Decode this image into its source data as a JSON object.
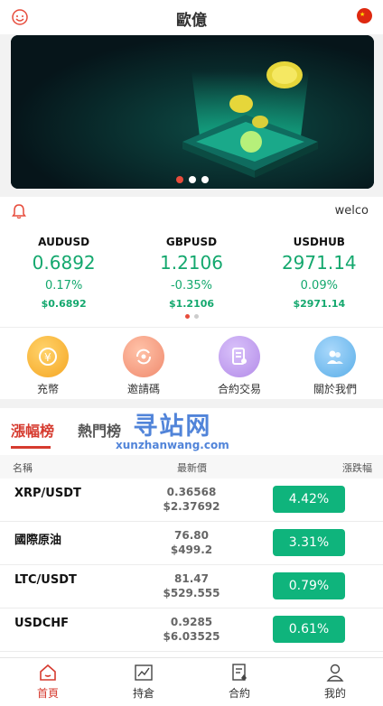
{
  "header": {
    "title": "歐億"
  },
  "notice": {
    "text": "welco"
  },
  "quotes": [
    {
      "symbol": "AUDUSD",
      "price": "0.6892",
      "percent": "0.17%",
      "sub": "$0.6892"
    },
    {
      "symbol": "GBPUSD",
      "price": "1.2106",
      "percent": "-0.35%",
      "sub": "$1.2106"
    },
    {
      "symbol": "USDHUB",
      "price": "2971.14",
      "percent": "0.09%",
      "sub": "$2971.14"
    }
  ],
  "shortcuts": [
    {
      "label": "充幣",
      "icon": "deposit-icon",
      "color": "#f5a623"
    },
    {
      "label": "邀請碼",
      "icon": "invite-icon",
      "color": "#f08a6e"
    },
    {
      "label": "合約交易",
      "icon": "contract-icon",
      "color": "#b38be8"
    },
    {
      "label": "關於我們",
      "icon": "about-icon",
      "color": "#5aaee8"
    }
  ],
  "rank": {
    "tabs": [
      "漲幅榜",
      "熱門榜"
    ],
    "watermark": {
      "big": "寻站网",
      "small": "xunzhanwang.com"
    },
    "columns": {
      "name": "名稱",
      "price": "最新價",
      "change": "漲跌幅"
    },
    "rows": [
      {
        "name": "XRP/USDT",
        "price": "0.36568",
        "price_usd": "$2.37692",
        "change": "4.42%"
      },
      {
        "name": "國際原油",
        "price": "76.80",
        "price_usd": "$499.2",
        "change": "3.31%"
      },
      {
        "name": "LTC/USDT",
        "price": "81.47",
        "price_usd": "$529.555",
        "change": "0.79%"
      },
      {
        "name": "USDCHF",
        "price": "0.9285",
        "price_usd": "$6.03525",
        "change": "0.61%"
      }
    ]
  },
  "nav": [
    {
      "label": "首頁",
      "icon": "home-icon"
    },
    {
      "label": "持倉",
      "icon": "chart-icon"
    },
    {
      "label": "合約",
      "icon": "contract-doc-icon"
    },
    {
      "label": "我的",
      "icon": "user-icon"
    }
  ],
  "colors": {
    "accent": "#d63b2f",
    "up": "#14a86e",
    "change_bg": "#0fb47c"
  }
}
